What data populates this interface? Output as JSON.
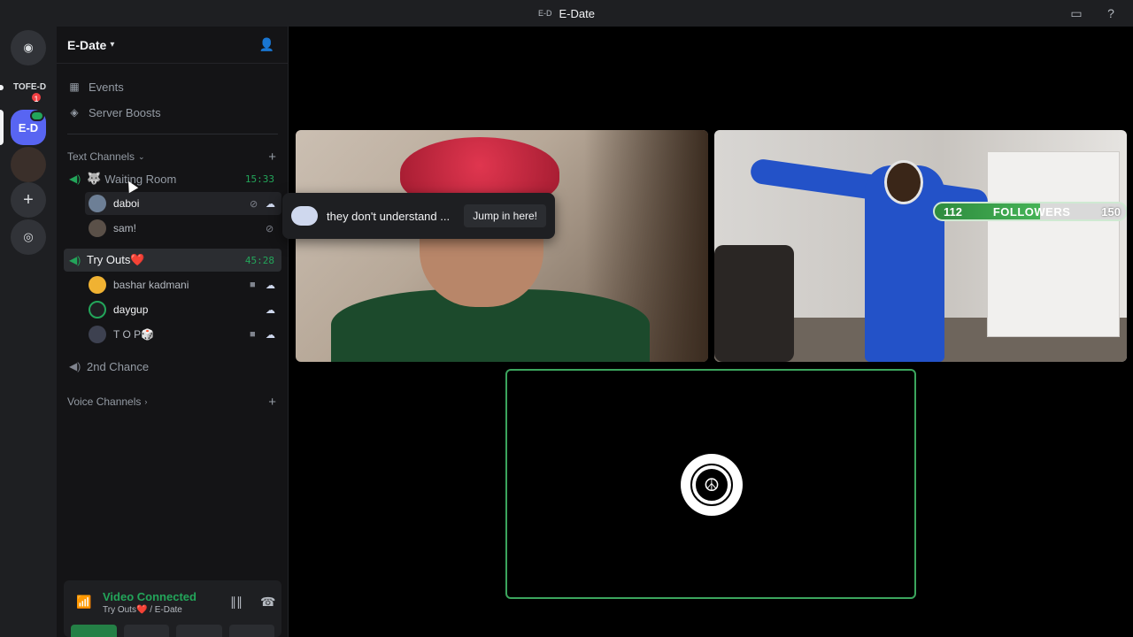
{
  "titlebar": {
    "badge": "E-D",
    "title": "E-Date",
    "inbox_icon": "inbox-icon",
    "help_icon": "help-icon"
  },
  "rail": {
    "tofe_label": "TOFE-D",
    "ed_label": "E-D",
    "ed_badge": "1"
  },
  "server": {
    "name": "E-Date",
    "events": "Events",
    "boosts": "Server Boosts",
    "text_category": "Text Channels",
    "voice_category": "Voice Channels",
    "channels": [
      {
        "name": "Waiting Room",
        "timer": "15:33"
      },
      {
        "name": "Try Outs❤️",
        "timer": "45:28"
      },
      {
        "name": "2nd Chance"
      }
    ],
    "waiting_users": [
      {
        "name": "daboi"
      },
      {
        "name": "sam!"
      }
    ],
    "tryout_users": [
      {
        "name": "bashar kadmani"
      },
      {
        "name": "daygup"
      },
      {
        "name": "T O P🎲"
      }
    ]
  },
  "voice": {
    "status": "Video Connected",
    "location": "Try Outs❤️ / E-Date"
  },
  "toast": {
    "message": "they don't understand ...",
    "action": "Jump in here!"
  },
  "overlay": {
    "current": "112",
    "label": "FOLLOWERS",
    "goal": "150"
  },
  "colors": {
    "accent": "#5865f2",
    "connected": "#23a55a",
    "danger": "#f23f43"
  }
}
